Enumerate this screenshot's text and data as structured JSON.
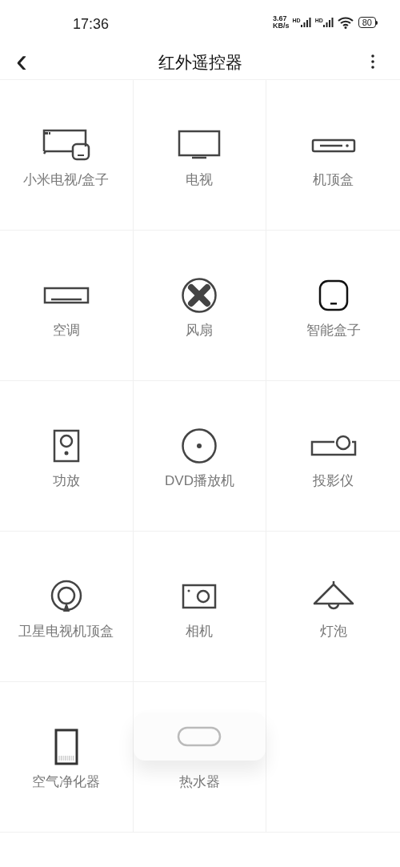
{
  "status_bar": {
    "time": "17:36",
    "speed_value": "3.67",
    "speed_unit": "KB/s",
    "sim_labels": [
      "HD",
      "HD"
    ],
    "battery": "80"
  },
  "header": {
    "title": "红外遥控器",
    "back": "‹"
  },
  "devices": [
    {
      "label": "小米电视/盒子",
      "kind": "mitv",
      "lifted": false
    },
    {
      "label": "电视",
      "kind": "tv",
      "lifted": false
    },
    {
      "label": "机顶盒",
      "kind": "stb",
      "lifted": false
    },
    {
      "label": "空调",
      "kind": "ac",
      "lifted": false
    },
    {
      "label": "风扇",
      "kind": "fan",
      "lifted": false
    },
    {
      "label": "智能盒子",
      "kind": "box",
      "lifted": false
    },
    {
      "label": "功放",
      "kind": "speaker",
      "lifted": false
    },
    {
      "label": "DVD播放机",
      "kind": "disc",
      "lifted": false
    },
    {
      "label": "投影仪",
      "kind": "projector",
      "lifted": false
    },
    {
      "label": "卫星电视机顶盒",
      "kind": "satellite",
      "lifted": false
    },
    {
      "label": "相机",
      "kind": "camera",
      "lifted": false
    },
    {
      "label": "灯泡",
      "kind": "lamp",
      "lifted": false
    },
    {
      "label": "空气净化器",
      "kind": "purifier",
      "lifted": false
    },
    {
      "label": "热水器",
      "kind": "heater",
      "lifted": true
    }
  ]
}
